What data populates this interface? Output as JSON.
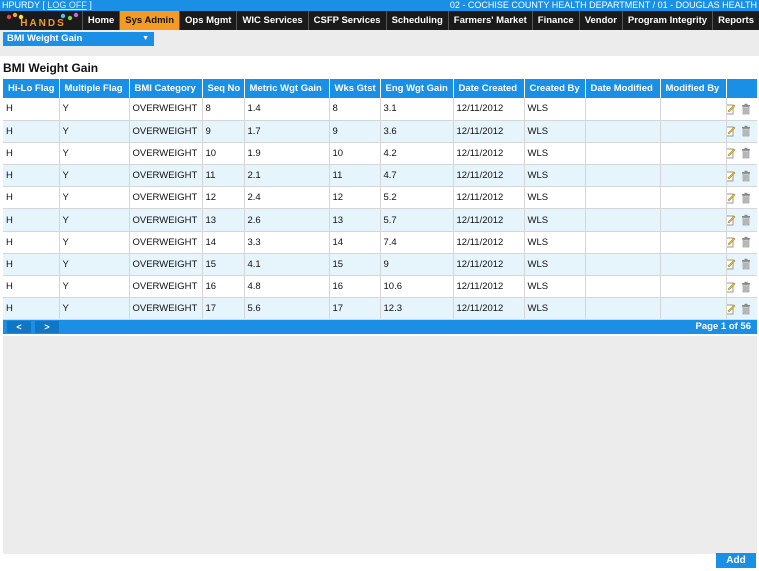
{
  "header": {
    "user": "HPURDY",
    "logout_label": "LOG OFF",
    "department": "02 - COCHISE COUNTY HEALTH DEPARTMENT / 01 - DOUGLAS HEALTH"
  },
  "logo": {
    "text": "HANDS"
  },
  "nav": [
    {
      "label": "Home",
      "name": "home",
      "active": false
    },
    {
      "label": "Sys Admin",
      "name": "sys-admin",
      "active": true
    },
    {
      "label": "Ops Mgmt",
      "name": "ops-mgmt",
      "active": false
    },
    {
      "label": "WIC Services",
      "name": "wic-services",
      "active": false
    },
    {
      "label": "CSFP Services",
      "name": "csfp-services",
      "active": false
    },
    {
      "label": "Scheduling",
      "name": "scheduling",
      "active": false
    },
    {
      "label": "Farmers' Market",
      "name": "farmers-market",
      "active": false
    },
    {
      "label": "Finance",
      "name": "finance",
      "active": false
    },
    {
      "label": "Vendor",
      "name": "vendor",
      "active": false
    },
    {
      "label": "Program Integrity",
      "name": "program-integrity",
      "active": false
    },
    {
      "label": "Reports",
      "name": "reports",
      "active": false
    }
  ],
  "module_select": {
    "value": "BMI Weight Gain"
  },
  "page_title": "BMI Weight Gain",
  "table": {
    "columns": [
      "Hi-Lo Flag",
      "Multiple Flag",
      "BMI Category",
      "Seq No",
      "Metric Wgt Gain",
      "Wks Gtst",
      "Eng Wgt Gain",
      "Date Created",
      "Created By",
      "Date Modified",
      "Modified By",
      ""
    ],
    "rows": [
      [
        "H",
        "Y",
        "OVERWEIGHT",
        "8",
        "1.4",
        "8",
        "3.1",
        "12/11/2012",
        "WLS",
        "",
        ""
      ],
      [
        "H",
        "Y",
        "OVERWEIGHT",
        "9",
        "1.7",
        "9",
        "3.6",
        "12/11/2012",
        "WLS",
        "",
        ""
      ],
      [
        "H",
        "Y",
        "OVERWEIGHT",
        "10",
        "1.9",
        "10",
        "4.2",
        "12/11/2012",
        "WLS",
        "",
        ""
      ],
      [
        "H",
        "Y",
        "OVERWEIGHT",
        "11",
        "2.1",
        "11",
        "4.7",
        "12/11/2012",
        "WLS",
        "",
        ""
      ],
      [
        "H",
        "Y",
        "OVERWEIGHT",
        "12",
        "2.4",
        "12",
        "5.2",
        "12/11/2012",
        "WLS",
        "",
        ""
      ],
      [
        "H",
        "Y",
        "OVERWEIGHT",
        "13",
        "2.6",
        "13",
        "5.7",
        "12/11/2012",
        "WLS",
        "",
        ""
      ],
      [
        "H",
        "Y",
        "OVERWEIGHT",
        "14",
        "3.3",
        "14",
        "7.4",
        "12/11/2012",
        "WLS",
        "",
        ""
      ],
      [
        "H",
        "Y",
        "OVERWEIGHT",
        "15",
        "4.1",
        "15",
        "9",
        "12/11/2012",
        "WLS",
        "",
        ""
      ],
      [
        "H",
        "Y",
        "OVERWEIGHT",
        "16",
        "4.8",
        "16",
        "10.6",
        "12/11/2012",
        "WLS",
        "",
        ""
      ],
      [
        "H",
        "Y",
        "OVERWEIGHT",
        "17",
        "5.6",
        "17",
        "12.3",
        "12/11/2012",
        "WLS",
        "",
        ""
      ]
    ]
  },
  "pager": {
    "prev": "<",
    "next": ">",
    "info": "Page 1 of 56"
  },
  "add_label": "Add",
  "colors": {
    "accent": "#1a8fe6",
    "active_tab": "#f59a23",
    "nav_bg": "#1a1a1a",
    "row_alt": "#e6f4fc"
  },
  "icons": {
    "edit": "edit-icon",
    "delete": "trash-icon"
  }
}
